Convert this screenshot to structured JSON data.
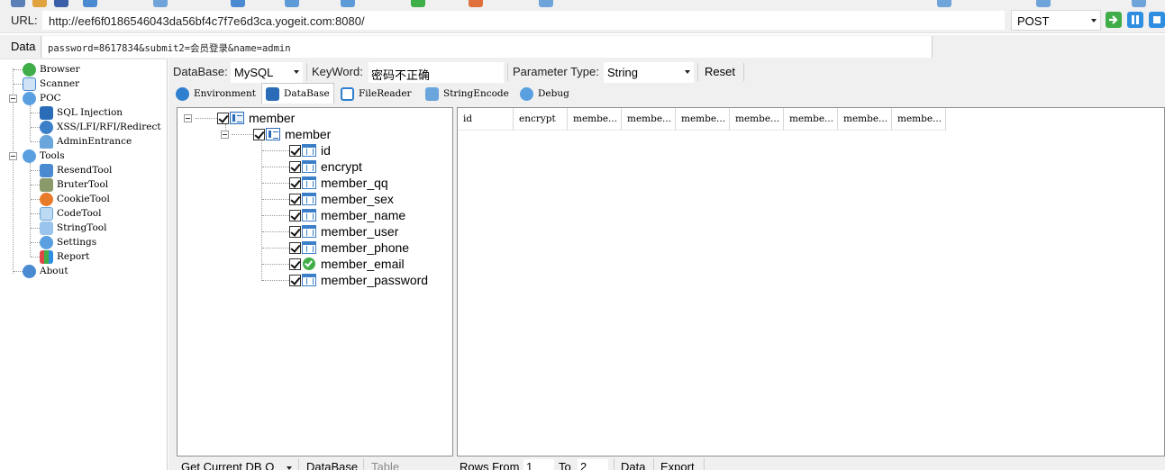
{
  "address_bar": {
    "url_label": "URL:",
    "url_value": "http://eef6f0186546043da56bf4c7f7e6d3ca.yogeit.com:8080/",
    "method_value": "POST"
  },
  "data_bar": {
    "label": "Data",
    "value": "password=8617834&submit2=会员登录&name=admin"
  },
  "nav": {
    "items": [
      {
        "label": "Browser",
        "icon": "globe-check-icon"
      },
      {
        "label": "Scanner",
        "icon": "scanner-icon"
      },
      {
        "label": "POC",
        "icon": "gear-icon"
      },
      {
        "label": "SQL Injection",
        "icon": "table-icon"
      },
      {
        "label": "XSS/LFI/RFI/Redirect",
        "icon": "gear-blue-icon"
      },
      {
        "label": "AdminEntrance",
        "icon": "user-icon"
      },
      {
        "label": "Tools",
        "icon": "gear-icon"
      },
      {
        "label": "ResendTool",
        "icon": "resend-icon"
      },
      {
        "label": "BruterTool",
        "icon": "bruter-icon"
      },
      {
        "label": "CookieTool",
        "icon": "cookie-icon"
      },
      {
        "label": "CodeTool",
        "icon": "monitor-icon"
      },
      {
        "label": "StringTool",
        "icon": "string-icon"
      },
      {
        "label": "Settings",
        "icon": "gear-icon"
      },
      {
        "label": "Report",
        "icon": "chart-icon"
      },
      {
        "label": "About",
        "icon": "info-globe-icon"
      }
    ]
  },
  "filter": {
    "database_label": "DataBase:",
    "database_value": "MySQL",
    "keyword_label": "KeyWord:",
    "keyword_value": "密码不正确",
    "parameter_type_label": "Parameter Type:",
    "parameter_type_value": "String",
    "reset_label": "Reset"
  },
  "tabs": [
    {
      "label": "Environment",
      "icon": "info-icon"
    },
    {
      "label": "DataBase",
      "icon": "database-icon"
    },
    {
      "label": "FileReader",
      "icon": "file-icon"
    },
    {
      "label": "StringEncode",
      "icon": "puzzle-icon"
    },
    {
      "label": "Debug",
      "icon": "gear-icon"
    }
  ],
  "tree": {
    "database": "member",
    "table": "member",
    "columns": [
      "id",
      "encrypt",
      "member_qq",
      "member_sex",
      "member_name",
      "member_user",
      "member_phone",
      "member_email",
      "member_password"
    ]
  },
  "grid": {
    "headers": [
      "id",
      "encrypt",
      "membe...",
      "membe...",
      "membe...",
      "membe...",
      "membe...",
      "membe...",
      "membe..."
    ]
  },
  "bottom": {
    "get_current": "Get Current DB O",
    "database_btn": "DataBase",
    "table_btn": "Table",
    "rows_from_label": "Rows From",
    "rows_from_value": "1",
    "to_label": "To",
    "to_value": "2",
    "data_btn": "Data",
    "export_btn": "Export"
  }
}
